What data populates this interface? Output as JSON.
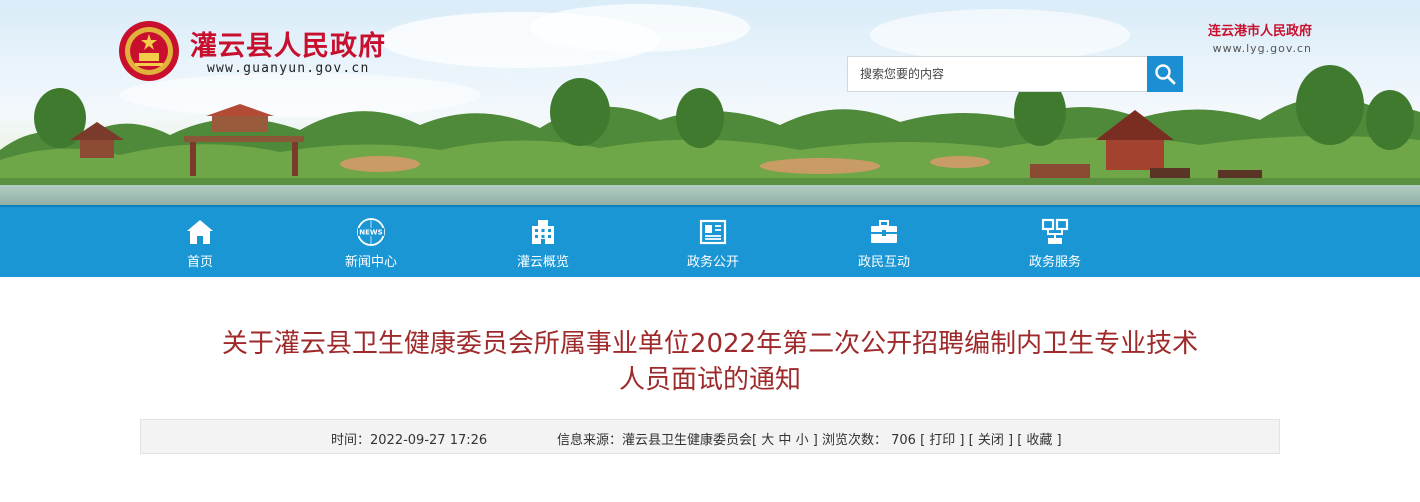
{
  "header": {
    "site_name": "灌云县人民政府",
    "site_domain": "www.guanyun.gov.cn",
    "city_name": "连云港市人民政府",
    "city_domain": "www.lyg.gov.cn",
    "search_placeholder": "搜索您要的内容",
    "search_icon": "search-icon"
  },
  "nav": {
    "items": [
      {
        "label": "首页",
        "icon": "home-icon"
      },
      {
        "label": "新闻中心",
        "icon": "news-icon"
      },
      {
        "label": "灌云概览",
        "icon": "building-icon"
      },
      {
        "label": "政务公开",
        "icon": "document-icon"
      },
      {
        "label": "政民互动",
        "icon": "briefcase-icon"
      },
      {
        "label": "政务服务",
        "icon": "network-icon"
      }
    ]
  },
  "article": {
    "title_line1": "关于灌云县卫生健康委员会所属事业单位2022年第二次公开招聘编制内卫生专业技术",
    "title_line2": "人员面试的通知",
    "time_label": "时间：",
    "time_value": "2022-09-27 17:26",
    "source_label": "信息来源：",
    "source_value": "灌云县卫生健康委员会",
    "font_size_label_prefix": "[",
    "font_large": "大",
    "font_medium": "中",
    "font_small": "小",
    "font_size_label_suffix": "]",
    "views_label": "浏览次数：",
    "views_value": "706",
    "print_label": "[ 打印 ]",
    "close_label": "[ 关闭 ]",
    "favorite_label": "[ 收藏 ]"
  },
  "colors": {
    "brand_red": "#c8102e",
    "nav_blue": "#1a96d5",
    "title_red": "#9e2a2b",
    "search_blue": "#1b8fd2"
  }
}
